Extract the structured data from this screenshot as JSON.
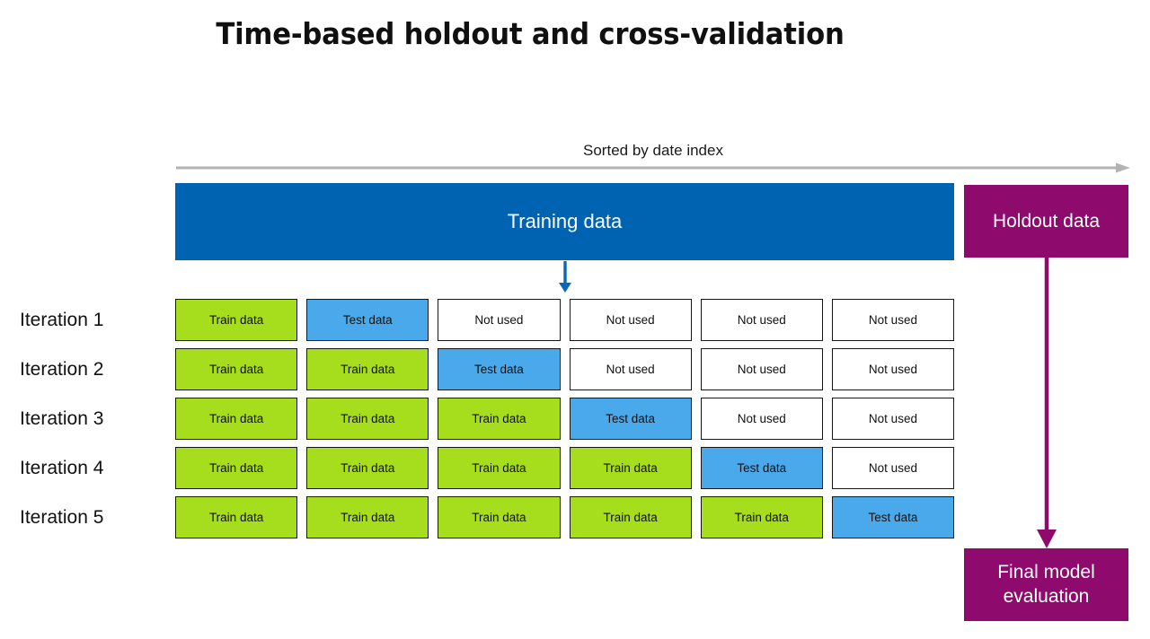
{
  "title": "Time-based holdout and cross-validation",
  "axis": {
    "label": "Sorted by date index",
    "arrow_color": "#b3b3b3",
    "direction": "right"
  },
  "training_bar": {
    "label": "Training data",
    "color": "#0063B1",
    "text_color": "#ffffff"
  },
  "holdout_box": {
    "label": "Holdout data",
    "color": "#8E0A6D",
    "text_color": "#ffffff"
  },
  "split_arrow": {
    "color": "#0063B1",
    "direction": "down"
  },
  "eval_arrow": {
    "color": "#8E0A6D",
    "direction": "down"
  },
  "final_box": {
    "line1": "Final model",
    "line2": "evaluation",
    "color": "#8E0A6D",
    "text_color": "#ffffff"
  },
  "legend_colors": {
    "train": "#A6DD1C",
    "test": "#4AA9EA",
    "unused": "#ffffff",
    "border": "#161616"
  },
  "cell_labels": {
    "train": "Train data",
    "test": "Test data",
    "unused": "Not used"
  },
  "iterations": [
    {
      "label": "Iteration 1",
      "cells": [
        {
          "type": "train",
          "text": "Train data"
        },
        {
          "type": "test",
          "text": "Test data"
        },
        {
          "type": "unused",
          "text": "Not used"
        },
        {
          "type": "unused",
          "text": "Not used"
        },
        {
          "type": "unused",
          "text": "Not used"
        },
        {
          "type": "unused",
          "text": "Not used"
        }
      ]
    },
    {
      "label": "Iteration 2",
      "cells": [
        {
          "type": "train",
          "text": "Train data"
        },
        {
          "type": "train",
          "text": "Train data"
        },
        {
          "type": "test",
          "text": "Test data"
        },
        {
          "type": "unused",
          "text": "Not used"
        },
        {
          "type": "unused",
          "text": "Not used"
        },
        {
          "type": "unused",
          "text": "Not used"
        }
      ]
    },
    {
      "label": "Iteration 3",
      "cells": [
        {
          "type": "train",
          "text": "Train data"
        },
        {
          "type": "train",
          "text": "Train data"
        },
        {
          "type": "train",
          "text": "Train data"
        },
        {
          "type": "test",
          "text": "Test data"
        },
        {
          "type": "unused",
          "text": "Not used"
        },
        {
          "type": "unused",
          "text": "Not used"
        }
      ]
    },
    {
      "label": "Iteration 4",
      "cells": [
        {
          "type": "train",
          "text": "Train data"
        },
        {
          "type": "train",
          "text": "Train data"
        },
        {
          "type": "train",
          "text": "Train data"
        },
        {
          "type": "train",
          "text": "Train data"
        },
        {
          "type": "test",
          "text": "Test data"
        },
        {
          "type": "unused",
          "text": "Not used"
        }
      ]
    },
    {
      "label": "Iteration 5",
      "cells": [
        {
          "type": "train",
          "text": "Train data"
        },
        {
          "type": "train",
          "text": "Train data"
        },
        {
          "type": "train",
          "text": "Train data"
        },
        {
          "type": "train",
          "text": "Train data"
        },
        {
          "type": "train",
          "text": "Train data"
        },
        {
          "type": "test",
          "text": "Test data"
        }
      ]
    }
  ]
}
